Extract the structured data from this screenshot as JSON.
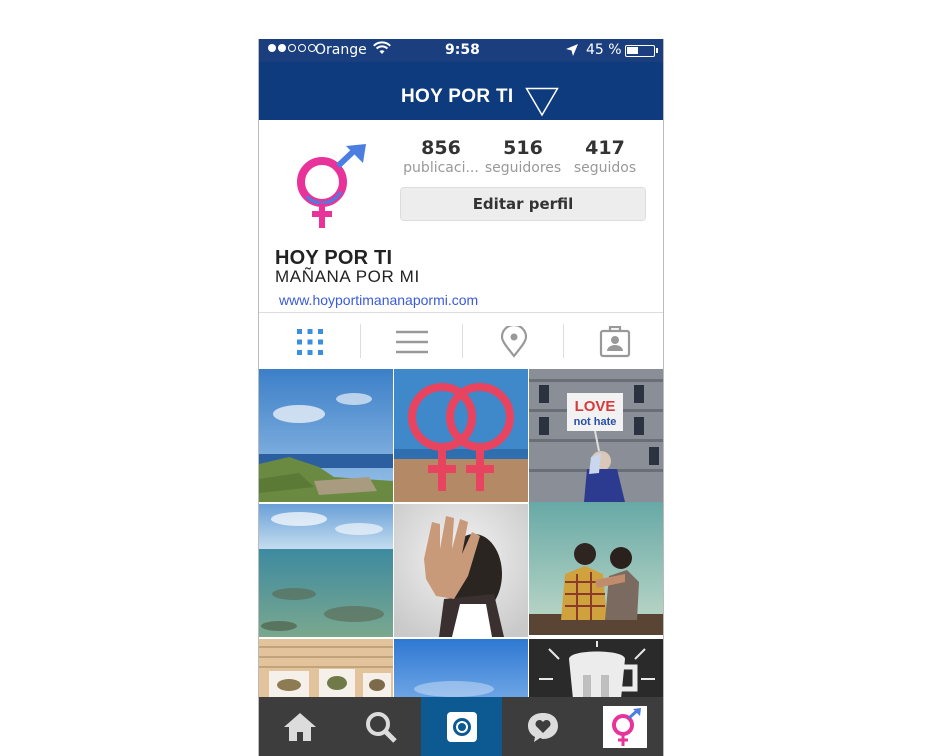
{
  "status_bar": {
    "carrier": "Orange",
    "time": "9:58",
    "battery_text": "45 %",
    "battery_level": 0.45
  },
  "header": {
    "title": "HOY POR TI"
  },
  "profile": {
    "stats": [
      {
        "value": "856",
        "label": "publicaci..."
      },
      {
        "value": "516",
        "label": "seguidores"
      },
      {
        "value": "417",
        "label": "seguidos"
      }
    ],
    "edit_button": "Editar perfil",
    "bio_name": "HOY POR TI",
    "bio_sub": "MAÑANA POR MI",
    "link": "www.hoyportimananapormi.com"
  },
  "tabs": [
    {
      "name": "grid-view",
      "icon": "grid-icon",
      "active": true
    },
    {
      "name": "list-view",
      "icon": "list-icon",
      "active": false
    },
    {
      "name": "location-view",
      "icon": "location-pin-icon",
      "active": false
    },
    {
      "name": "tagged-view",
      "icon": "tagged-person-icon",
      "active": false
    }
  ],
  "photos": [
    {
      "name": "photo-coast",
      "sign_top": "",
      "sign_bottom": ""
    },
    {
      "name": "photo-female-symbols",
      "sign_top": "",
      "sign_bottom": ""
    },
    {
      "name": "photo-love-not-hate",
      "sign_top": "LOVE",
      "sign_bottom": "not hate"
    },
    {
      "name": "photo-sea",
      "sign_top": "",
      "sign_bottom": ""
    },
    {
      "name": "photo-stop-hand",
      "sign_top": "",
      "sign_bottom": ""
    },
    {
      "name": "photo-couple",
      "sign_top": "",
      "sign_bottom": ""
    },
    {
      "name": "photo-drawings",
      "sign_top": "",
      "sign_bottom": ""
    },
    {
      "name": "photo-sky",
      "sign_top": "",
      "sign_bottom": ""
    },
    {
      "name": "photo-beer-mug",
      "sign_top": "",
      "sign_bottom": ""
    }
  ],
  "tabbar": {
    "items": [
      "home-icon",
      "search-icon",
      "camera-icon",
      "activity-heart-icon",
      "profile-avatar-icon"
    ],
    "active": "camera-icon"
  },
  "colors": {
    "header": "#0d3b7d",
    "status_bar": "#1b3f7e",
    "tabbar": "#3d3d3d",
    "tabbar_active": "#0d5a93",
    "link": "#3a5bd9",
    "logo_pink": "#e8339a",
    "logo_blue": "#4a7ee0"
  }
}
